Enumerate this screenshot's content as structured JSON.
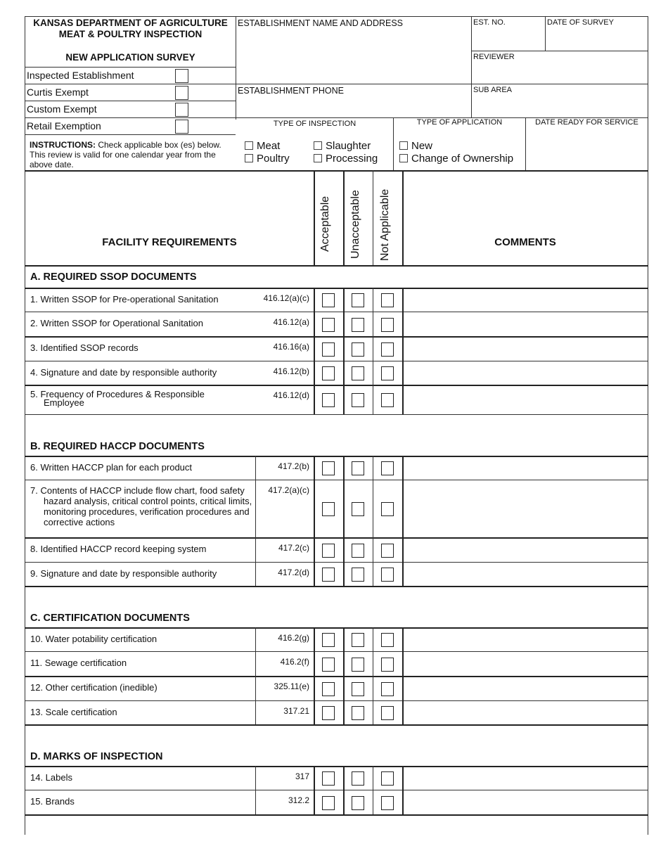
{
  "header": {
    "agency_line1": "KANSAS DEPARTMENT OF AGRICULTURE",
    "agency_line2": "MEAT & POULTRY INSPECTION",
    "form_title": "NEW APPLICATION SURVEY",
    "establishment_types": [
      {
        "label": "Inspected Establishment",
        "checked": false
      },
      {
        "label": "Curtis Exempt",
        "checked": false
      },
      {
        "label": "Custom Exempt",
        "checked": false
      },
      {
        "label": "Retail Exemption",
        "checked": false
      }
    ],
    "instructions_bold": "INSTRUCTIONS:",
    "instructions_text": " Check applicable box (es) below. This review is valid for one calendar year from the above date.",
    "fields": {
      "establishment_name_address": {
        "label": "ESTABLISHMENT NAME AND ADDRESS",
        "value": ""
      },
      "est_no": {
        "label": "EST. NO.",
        "value": ""
      },
      "date_of_survey": {
        "label": "DATE OF SURVEY",
        "value": ""
      },
      "reviewer": {
        "label": "REVIEWER",
        "value": ""
      },
      "establishment_phone": {
        "label": "ESTABLISHMENT PHONE",
        "value": ""
      },
      "sub_area": {
        "label": "SUB AREA",
        "value": ""
      },
      "date_ready_for_service": {
        "label": "DATE READY FOR SERVICE",
        "value": ""
      }
    },
    "type_of_inspection": {
      "label": "TYPE OF INSPECTION",
      "options": [
        {
          "label": "Meat",
          "checked": false
        },
        {
          "label": "Poultry",
          "checked": false
        },
        {
          "label": "Slaughter",
          "checked": false
        },
        {
          "label": "Processing",
          "checked": false
        }
      ]
    },
    "type_of_application": {
      "label": "TYPE OF APPLICATION",
      "options": [
        {
          "label": "New",
          "checked": false
        },
        {
          "label": "Change of Ownership",
          "checked": false
        }
      ]
    }
  },
  "table": {
    "facility_header": "FACILITY REQUIREMENTS",
    "rating_columns": [
      "Acceptable",
      "Unacceptable",
      "Not Applicable"
    ],
    "comments_header": "COMMENTS",
    "sections": [
      {
        "title": "A.  REQUIRED SSOP DOCUMENTS",
        "items": [
          {
            "text": "1.  Written SSOP for Pre-operational Sanitation",
            "reg": "416.12(a)(c)"
          },
          {
            "text": "2.  Written SSOP for Operational Sanitation",
            "reg": "416.12(a)"
          },
          {
            "text": "3.  Identified SSOP records",
            "reg": "416.16(a)"
          },
          {
            "text": "4.  Signature and date by responsible authority",
            "reg": "416.12(b)"
          },
          {
            "text": "5.  Frequency of Procedures & Responsible Employee",
            "reg": "416.12(d)"
          }
        ]
      },
      {
        "title": "B.  REQUIRED HACCP DOCUMENTS",
        "items": [
          {
            "text": "6.  Written HACCP plan for each product",
            "reg": "417.2(b)"
          },
          {
            "text": "7.  Contents of HACCP include flow chart, food safety hazard analysis, critical control points, critical limits, monitoring procedures, verification procedures and corrective actions",
            "reg": "417.2(a)(c)"
          },
          {
            "text": "8. Identified HACCP record keeping system",
            "reg": "417.2(c)"
          },
          {
            "text": "9. Signature and date by responsible authority",
            "reg": "417.2(d)"
          }
        ]
      },
      {
        "title": "C.  CERTIFICATION DOCUMENTS",
        "items": [
          {
            "text": "10.  Water potability certification",
            "reg": "416.2(g)"
          },
          {
            "text": "11.  Sewage certification",
            "reg": "416.2(f)"
          },
          {
            "text": "12.  Other certification (inedible)",
            "reg": "325.11(e)"
          },
          {
            "text": "13.  Scale certification",
            "reg": "317.21"
          }
        ]
      },
      {
        "title": "D.  MARKS OF INSPECTION",
        "items": [
          {
            "text": "14.  Labels",
            "reg": "317"
          },
          {
            "text": "15.  Brands",
            "reg": "312.2"
          }
        ]
      }
    ]
  }
}
